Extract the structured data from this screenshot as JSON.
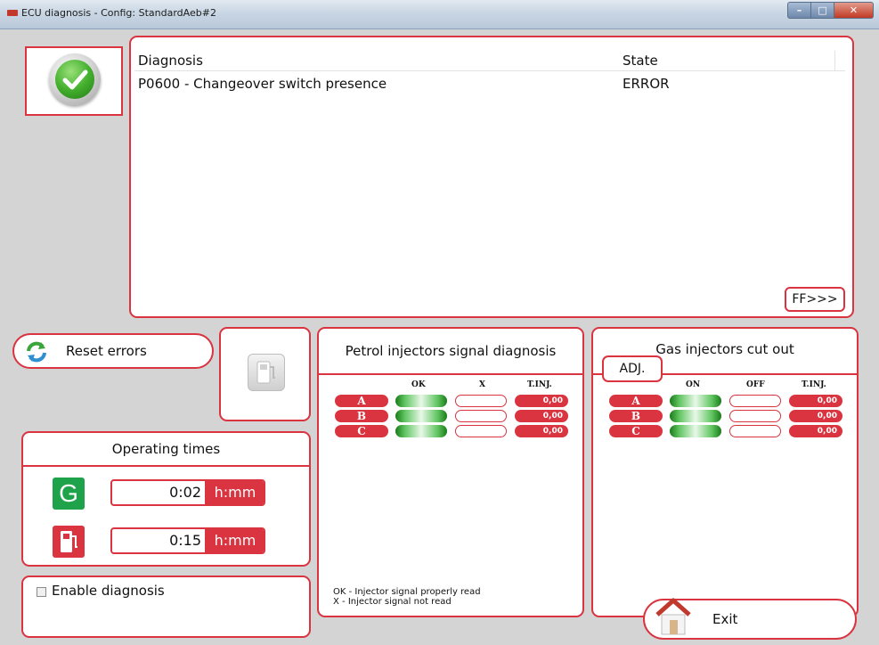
{
  "window": {
    "title": "ECU diagnosis - Config: StandardAeb#2"
  },
  "diagnosis": {
    "col_diagnosis": "Diagnosis",
    "col_state": "State",
    "rows": [
      {
        "diagnosis": "P0600 - Changeover switch presence",
        "state": "ERROR"
      }
    ],
    "ff_label": "FF>>>"
  },
  "reset": {
    "label": "Reset errors"
  },
  "operating_times": {
    "title": "Operating times",
    "gas_icon_letter": "G",
    "gas_value": "0:02",
    "petrol_value": "0:15",
    "unit": "h:mm"
  },
  "enable_diagnosis": {
    "label": "Enable diagnosis",
    "checked": false
  },
  "petrol_injectors": {
    "title": "Petrol injectors signal diagnosis",
    "col_ok": "OK",
    "col_x": "X",
    "col_tinj": "T.INJ.",
    "channels": [
      {
        "name": "A",
        "tinj": "0,00"
      },
      {
        "name": "B",
        "tinj": "0,00"
      },
      {
        "name": "C",
        "tinj": "0,00"
      }
    ],
    "legend_ok": "OK - Injector signal properly read",
    "legend_x": "X - Injector signal not read"
  },
  "gas_injectors": {
    "title": "Gas injectors cut out",
    "adj_label": "ADJ.",
    "col_on": "ON",
    "col_off": "OFF",
    "col_tinj": "T.INJ.",
    "channels": [
      {
        "name": "A",
        "tinj": "0,00"
      },
      {
        "name": "B",
        "tinj": "0,00"
      },
      {
        "name": "C",
        "tinj": "0,00"
      }
    ]
  },
  "exit": {
    "label": "Exit"
  },
  "colors": {
    "accent": "#d9343f",
    "ok_green": "#1fa34a"
  },
  "icons": [
    "check-icon",
    "refresh-icon",
    "fuel-pump-icon",
    "gas-g-icon",
    "home-exit-icon"
  ]
}
